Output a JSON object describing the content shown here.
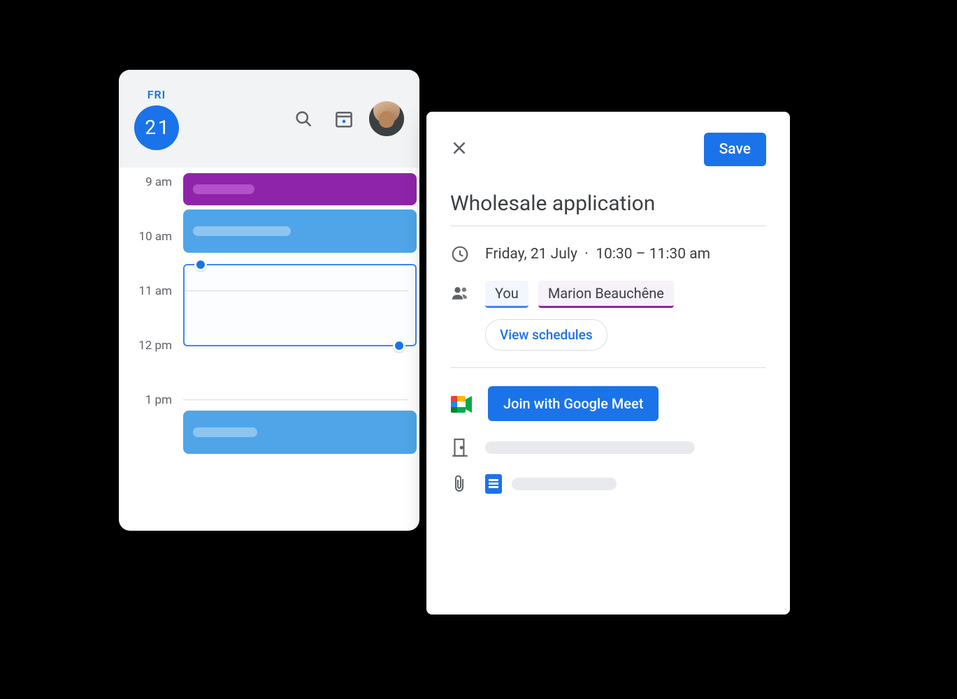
{
  "calendar": {
    "day_label": "FRI",
    "day_number": "21",
    "times": [
      "9 am",
      "10 am",
      "11 am",
      "12 pm",
      "1 pm"
    ]
  },
  "event": {
    "save_label": "Save",
    "title": "Wholesale application",
    "date": "Friday, 21 July",
    "time_range": "10:30 – 11:30 am",
    "attendees": {
      "you": "You",
      "guest": "Marion Beauchêne"
    },
    "view_schedules_label": "View schedules",
    "join_meet_label": "Join with Google Meet"
  }
}
